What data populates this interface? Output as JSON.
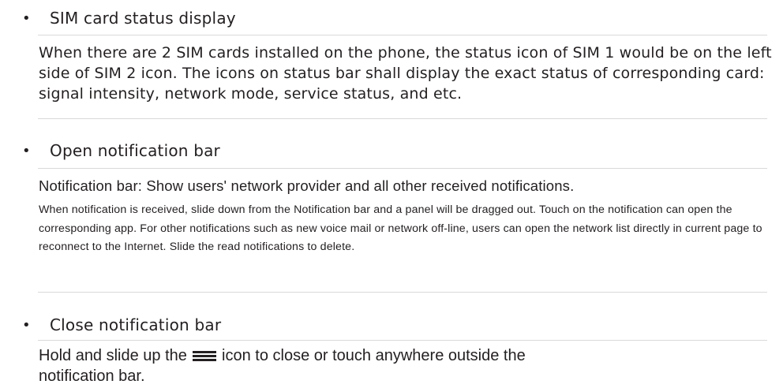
{
  "sections": [
    {
      "heading": "SIM card status display",
      "paragraphs": [
        "When there are 2 SIM cards installed on the phone, the status icon of SIM 1 would be on the left side of SIM 2 icon. The icons on status bar shall display the exact status of corresponding card: signal intensity, network mode, service status, and etc."
      ]
    },
    {
      "heading": "Open notification bar",
      "paragraphs": [
        "Notification bar: Show users' network provider and all other received notifications.",
        "When notification is received, slide down from the Notification bar and a panel will be dragged out. Touch on the notification can open the corresponding app. For other notifications such as new voice mail or network off-line, users can open the network list directly in current page to reconnect to the Internet. Slide the read notifications to delete."
      ]
    },
    {
      "heading": "Close notification bar",
      "paragraphs": [],
      "text_before_icon": "Hold and slide up the",
      "icon": "menu-icon",
      "text_after_icon": "icon to close or touch anywhere outside the",
      "text_line2": "notification bar."
    }
  ],
  "bullet": "•"
}
